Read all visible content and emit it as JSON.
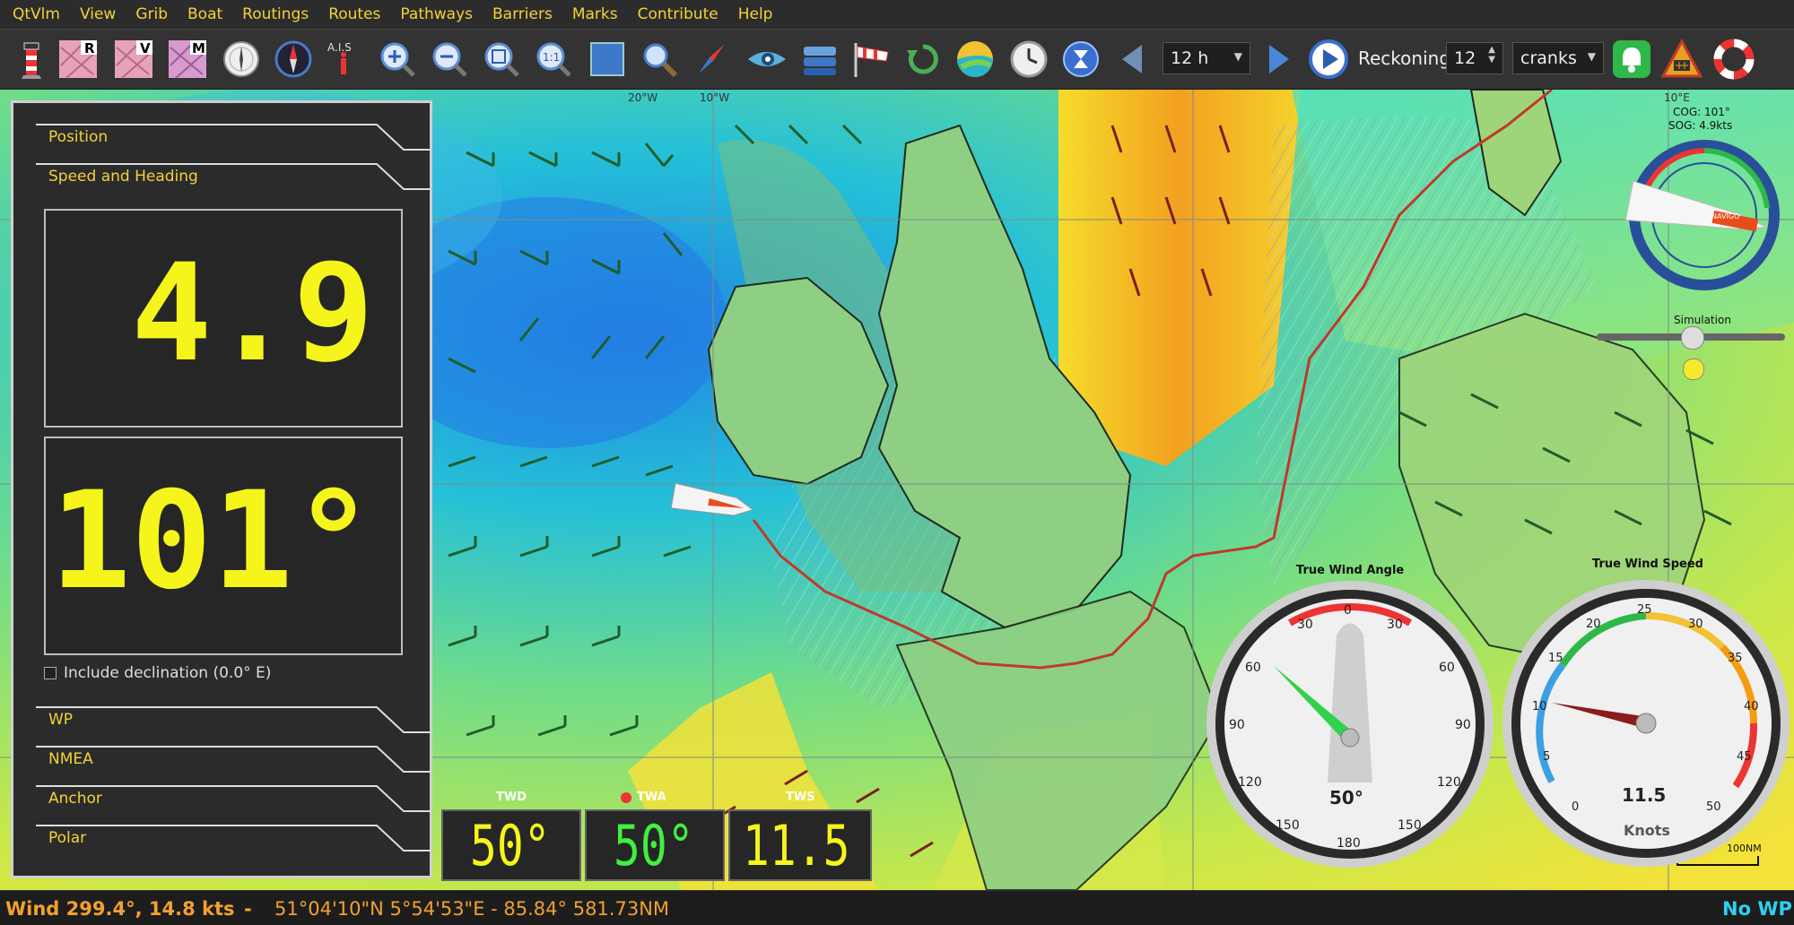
{
  "menu": [
    "QtVlm",
    "View",
    "Grib",
    "Boat",
    "Routings",
    "Routes",
    "Pathways",
    "Barriers",
    "Marks",
    "Contribute",
    "Help"
  ],
  "toolbar": {
    "timestep": "12 h",
    "reckoning_label": "Reckoning",
    "reckoning_value": "12",
    "units": "cranks",
    "ais_label": "A.I.S",
    "zoom_1to1": "1:1"
  },
  "panel": {
    "sections_top": [
      "Position",
      "Speed and Heading"
    ],
    "speed_value": "4.9",
    "heading_value": "101°",
    "declination_label": "Include declination (0.0° E)",
    "sections_bottom": [
      "WP",
      "NMEA",
      "Anchor",
      "Polar"
    ]
  },
  "instruments": {
    "twd_label": "TWD",
    "twd_value": "50°",
    "twa_label": "TWA",
    "twa_value": "50°",
    "tws_label": "TWS",
    "tws_value": "11.5"
  },
  "gauges": {
    "twa_title": "True Wind Angle",
    "twa_value": "50°",
    "twa_ticks": [
      "0",
      "30",
      "30",
      "60",
      "60",
      "90",
      "90",
      "120",
      "120",
      "150",
      "150",
      "180"
    ],
    "tws_title": "True Wind Speed",
    "tws_value": "11.5",
    "tws_unit": "Knots",
    "tws_ticks": [
      "0",
      "5",
      "10",
      "15",
      "20",
      "25",
      "30",
      "35",
      "40",
      "45",
      "50"
    ]
  },
  "compass": {
    "cog": "COG: 101°",
    "sog": "SOG: 4.9kts",
    "boat_label": "NAVIGO",
    "simulation_label": "Simulation"
  },
  "map": {
    "lon_labels": [
      "20°W",
      "10°W",
      "10°E"
    ],
    "scale_label": "100NM"
  },
  "status": {
    "wind": "Wind 299.4°, 14.8 kts",
    "sep": "-",
    "position": "51°04'10\"N  5°54'53\"E - 85.84°  581.73NM",
    "wp": "No WP"
  },
  "colors": {
    "accent_yellow": "#f2d23a",
    "status_orange": "#f2a12e",
    "digital_yellow": "#f5f51c",
    "digital_green": "#3ff03f",
    "route_red": "#c0392b"
  }
}
